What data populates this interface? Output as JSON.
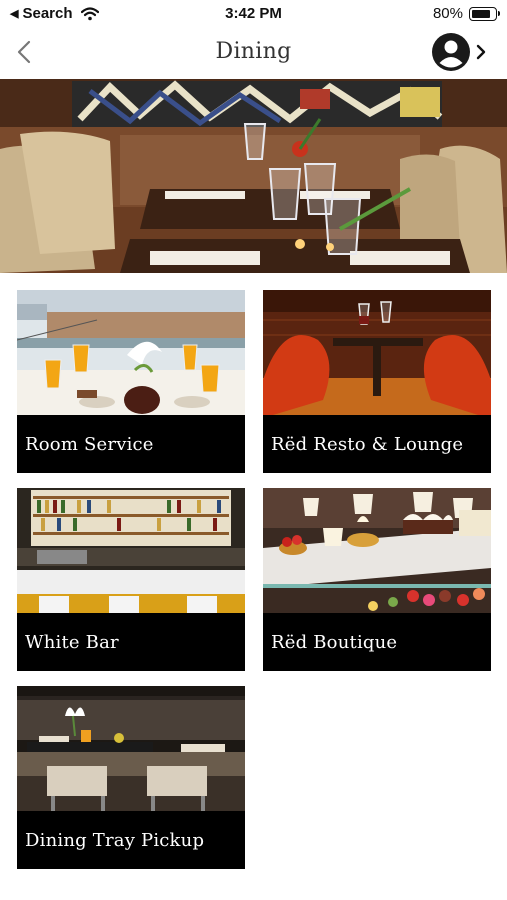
{
  "status_bar": {
    "back_app": "Search",
    "time": "3:42 PM",
    "battery": "80%",
    "battery_level": 0.8
  },
  "nav": {
    "title": "Dining",
    "back_icon": "chevron-left-icon",
    "profile_icon": "user-avatar-icon",
    "profile_chevron_icon": "chevron-right-icon"
  },
  "tiles": [
    {
      "label": "Room Service"
    },
    {
      "label": "Rëd Resto & Lounge"
    },
    {
      "label": "White Bar"
    },
    {
      "label": "Rëd Boutique"
    },
    {
      "label": "Dining Tray Pickup"
    }
  ],
  "colors": {
    "caption_bg": "#000000",
    "caption_text": "#ffffff",
    "accent_red": "#c8321c"
  }
}
